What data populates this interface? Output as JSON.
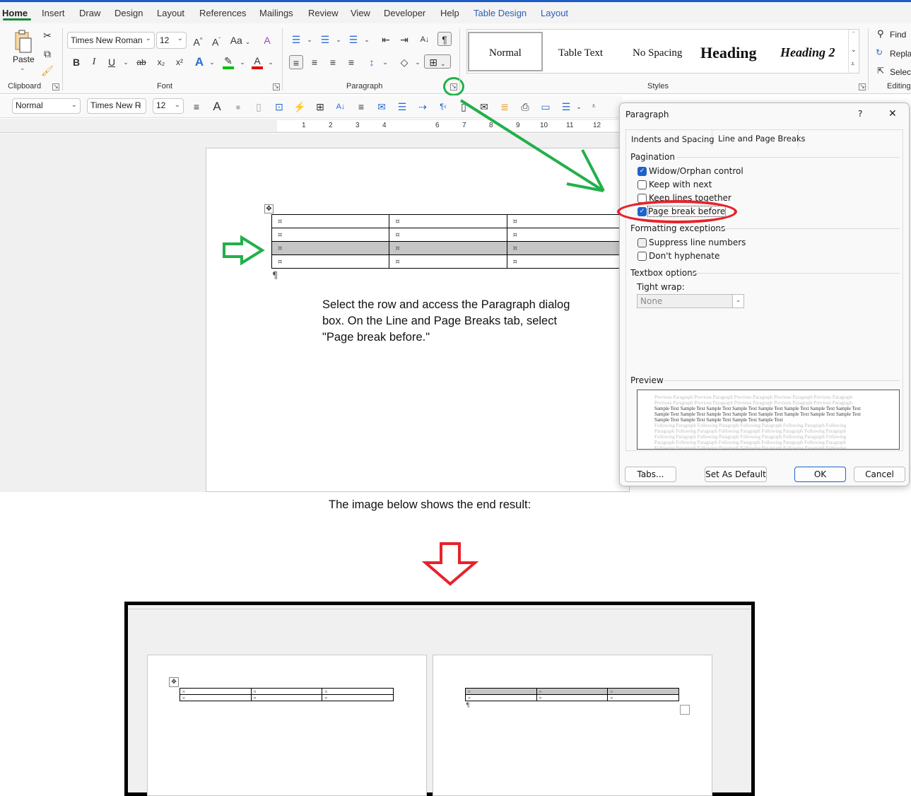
{
  "menubar": {
    "tabs": [
      "Home",
      "Insert",
      "Draw",
      "Design",
      "Layout",
      "References",
      "Mailings",
      "Review",
      "View",
      "Developer",
      "Help"
    ],
    "context_tabs": [
      "Table Design",
      "Layout"
    ],
    "active_tab": "Home"
  },
  "ribbon": {
    "clipboard": {
      "paste_label": "Paste",
      "group_label": "Clipboard"
    },
    "font": {
      "font_name": "Times New Roman",
      "font_size": "12",
      "case_label": "Aa",
      "group_label": "Font",
      "bold": "B",
      "italic": "I",
      "underline": "U",
      "strike": "ab",
      "subscript": "x₂",
      "superscript": "x²",
      "grow": "A^",
      "shrink": "Aˇ",
      "text_effects": "A",
      "highlight_color": "#00c000",
      "font_color": "#e00000"
    },
    "paragraph": {
      "group_label": "Paragraph",
      "show_marks": "¶"
    },
    "styles": {
      "group_label": "Styles",
      "items": [
        "Normal",
        "Table Text",
        "No Spacing",
        "Heading",
        "Heading 2"
      ],
      "selected": "Normal"
    },
    "editing": {
      "group_label": "Editing",
      "find": "Find",
      "replace": "Repla",
      "select": "Select"
    }
  },
  "quick_toolbar": {
    "style": "Normal",
    "font": "Times New R",
    "size": "12"
  },
  "ruler": {
    "numbers": [
      "1",
      "2",
      "3",
      "4",
      "6",
      "7",
      "8",
      "9",
      "10",
      "11",
      "12"
    ]
  },
  "document": {
    "table": {
      "rows": [
        [
          "¤",
          "¤",
          "¤"
        ],
        [
          "¤",
          "¤",
          "¤"
        ],
        [
          "¤",
          "¤",
          "¤"
        ],
        [
          "¤",
          "¤",
          "¤"
        ]
      ],
      "selected_row": 2
    },
    "pilcrow": "¶"
  },
  "instruction": "Select the row and access the Paragraph dialog box. On the Line and Page Breaks tab, select \"Page break before.\"",
  "result_caption": "The image below shows the end result:",
  "dialog": {
    "title": "Paragraph",
    "help": "?",
    "close": "✕",
    "tabs": [
      "Indents and Spacing",
      "Line and Page Breaks"
    ],
    "active_tab": "Line and Page Breaks",
    "pagination": {
      "label": "Pagination",
      "options": [
        {
          "label": "Widow/Orphan control",
          "checked": true
        },
        {
          "label": "Keep with next",
          "checked": false
        },
        {
          "label": "Keep lines together",
          "checked": false
        },
        {
          "label": "Page break before",
          "checked": true
        }
      ]
    },
    "formatting": {
      "label": "Formatting exceptions",
      "options": [
        {
          "label": "Suppress line numbers",
          "checked": false
        },
        {
          "label": "Don't hyphenate",
          "checked": false
        }
      ]
    },
    "textbox": {
      "label": "Textbox options",
      "tight_wrap_label": "Tight wrap:",
      "tight_wrap_value": "None"
    },
    "preview": {
      "label": "Preview",
      "previous": "Previous Paragraph Previous Paragraph Previous Paragraph Previous Paragraph Previous Paragraph",
      "sample1": "Sample Text Sample Text Sample Text Sample Text Sample Text Sample Text Sample Text Sample Text",
      "sample2": "Sample Text Sample Text Sample Text Sample Text Sample Text",
      "following1": "Following Paragraph Following Paragraph Following Paragraph Following Paragraph Following",
      "following2": "Paragraph Following Paragraph Following Paragraph Following Paragraph Following Paragraph"
    },
    "buttons": {
      "tabs": "Tabs...",
      "set_default": "Set As Default",
      "ok": "OK",
      "cancel": "Cancel"
    }
  },
  "annotations": {
    "green_color": "#22b04a",
    "red_color": "#e8222a"
  },
  "result_image": {
    "page1_rows": [
      [
        "¤",
        "¤",
        "¤"
      ],
      [
        "¤",
        "¤",
        "¤"
      ]
    ],
    "page2_rows": [
      [
        "¤",
        "¤",
        "¤"
      ],
      [
        "¤",
        "¤",
        "¤"
      ]
    ]
  }
}
